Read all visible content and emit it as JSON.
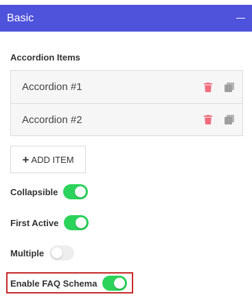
{
  "panel": {
    "title": "Basic",
    "collapse_icon": "minus-icon"
  },
  "accordion_section": {
    "label": "Accordion Items",
    "items": [
      {
        "label": "Accordion #1"
      },
      {
        "label": "Accordion #2"
      }
    ],
    "delete_icon": "trash-icon",
    "duplicate_icon": "copy-icon",
    "add_button_label": "ADD ITEM",
    "add_button_icon": "plus-icon"
  },
  "toggles": [
    {
      "label": "Collapsible",
      "on": true
    },
    {
      "label": "First Active",
      "on": true
    },
    {
      "label": "Multiple",
      "on": false
    },
    {
      "label": "Enable FAQ Schema",
      "on": true,
      "highlighted": true
    }
  ],
  "colors": {
    "header_bg": "#4f52db",
    "toggle_on": "#2bd35a",
    "toggle_off": "#eeeeee",
    "delete_icon": "#f26d7d",
    "duplicate_icon": "#b5b5b5",
    "highlight_border": "#c62828"
  }
}
